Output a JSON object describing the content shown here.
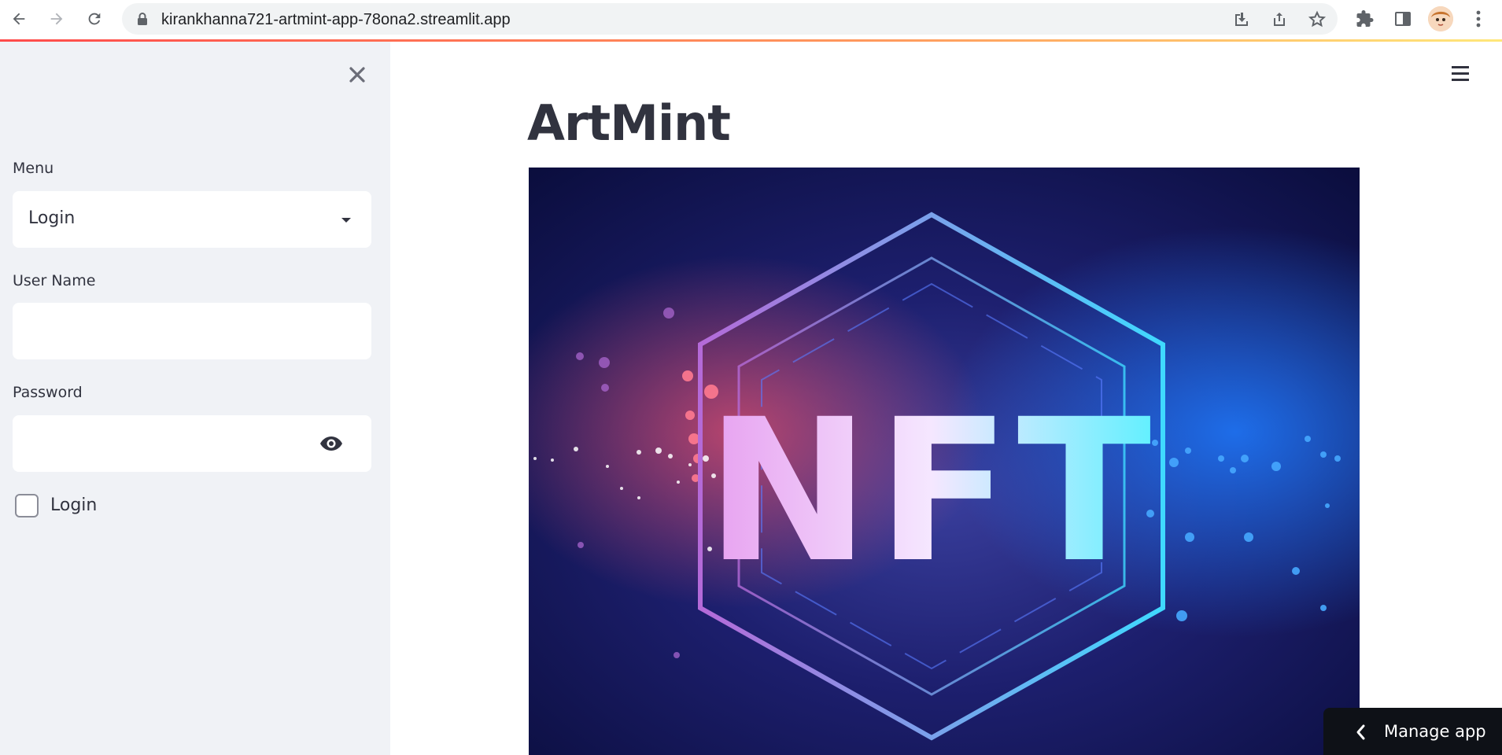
{
  "browser": {
    "url": "kirankhanna721-artmint-app-78ona2.streamlit.app"
  },
  "sidebar": {
    "menu_label": "Menu",
    "menu_selected": "Login",
    "username_label": "User Name",
    "username_value": "",
    "password_label": "Password",
    "password_value": "",
    "login_checkbox_label": "Login",
    "login_checked": false
  },
  "main": {
    "title": "ArtMint",
    "hero_text": "NFT"
  },
  "manage_app": {
    "label": "Manage app"
  },
  "colors": {
    "sidebar_bg": "#f0f2f6",
    "text": "#31333f",
    "accent_gradient_start": "#ff4b4b",
    "accent_gradient_end": "#ffe77a",
    "manage_bg": "#0e1117"
  }
}
